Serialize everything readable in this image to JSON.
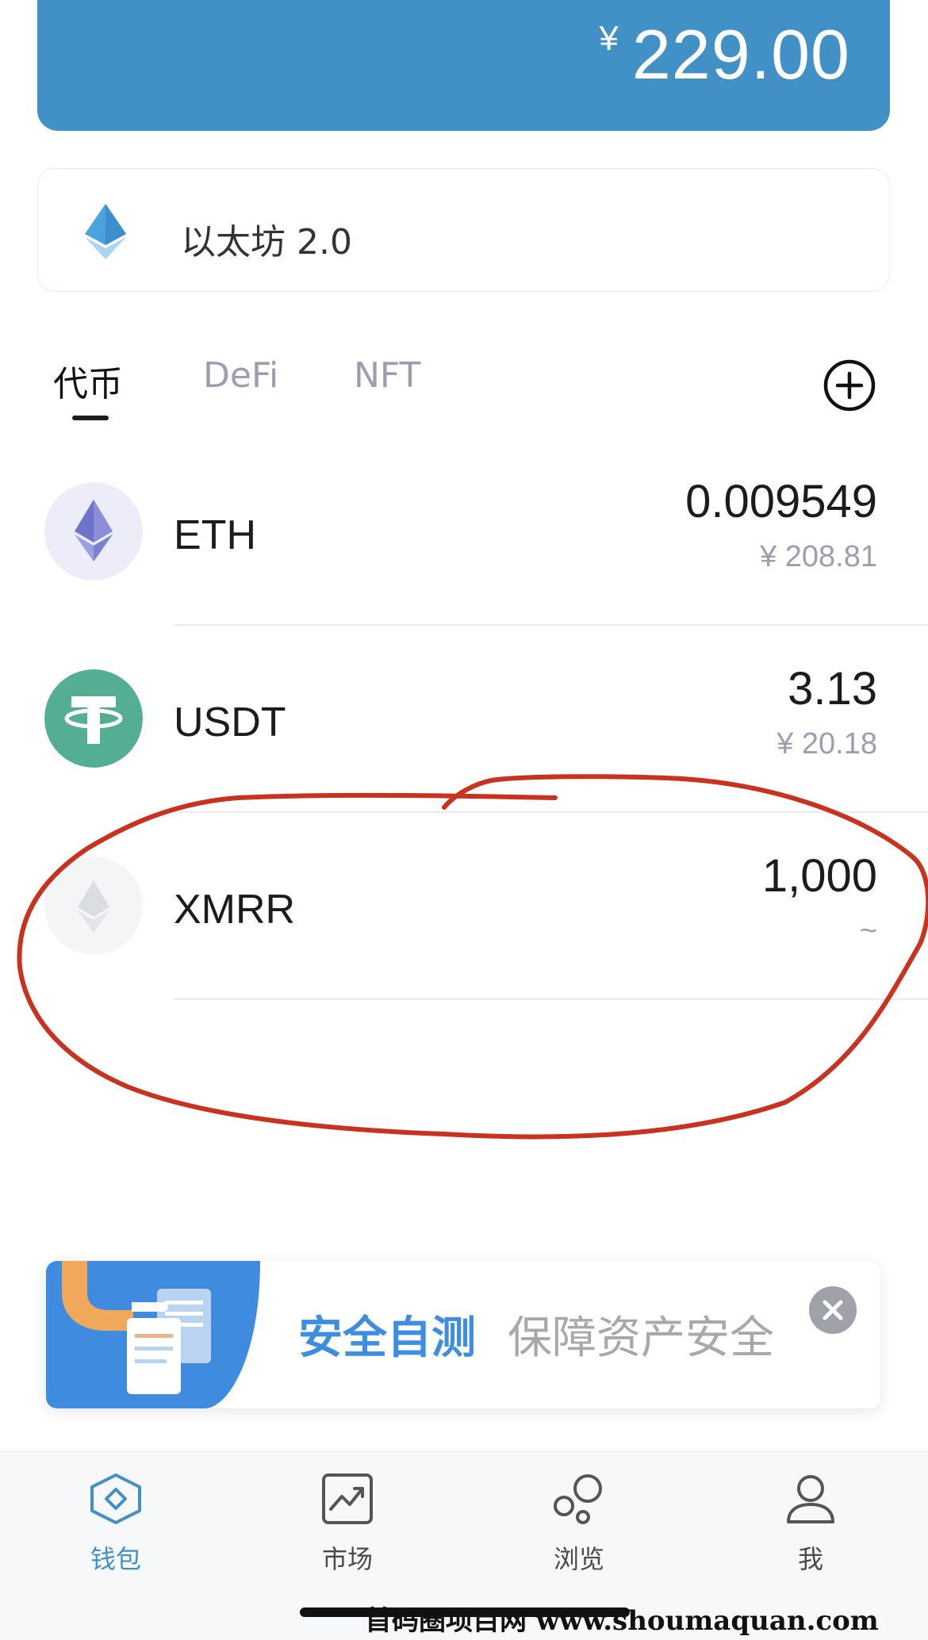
{
  "balance": {
    "currency_symbol": "¥",
    "amount": "229.00"
  },
  "network": {
    "label": "以太坊 2.0",
    "icon": "ethereum-diamond-icon"
  },
  "tabs": [
    {
      "label": "代币",
      "active": true
    },
    {
      "label": "DeFi",
      "active": false
    },
    {
      "label": "NFT",
      "active": false
    }
  ],
  "tokens": [
    {
      "symbol": "ETH",
      "amount": "0.009549",
      "value": "¥ 208.81",
      "icon": "ethereum-icon"
    },
    {
      "symbol": "USDT",
      "amount": "3.13",
      "value": "¥ 20.18",
      "icon": "tether-icon"
    },
    {
      "symbol": "XMRR",
      "amount": "1,000",
      "value": "~",
      "icon": "ethereum-gray-icon"
    }
  ],
  "promo": {
    "title": "安全自测",
    "subtitle": "保障资产安全"
  },
  "bottom_nav": [
    {
      "label": "钱包",
      "icon": "wallet-icon",
      "active": true
    },
    {
      "label": "市场",
      "icon": "market-chart-icon",
      "active": false
    },
    {
      "label": "浏览",
      "icon": "browse-bubbles-icon",
      "active": false
    },
    {
      "label": "我",
      "icon": "profile-icon",
      "active": false
    }
  ],
  "watermark": "首码圈项目网 www.shoumaquan.com",
  "colors": {
    "brand_blue": "#4190c6",
    "annotation_red": "#c8321f",
    "tether_green": "#53ae94",
    "muted_text": "#9a9eaf"
  }
}
